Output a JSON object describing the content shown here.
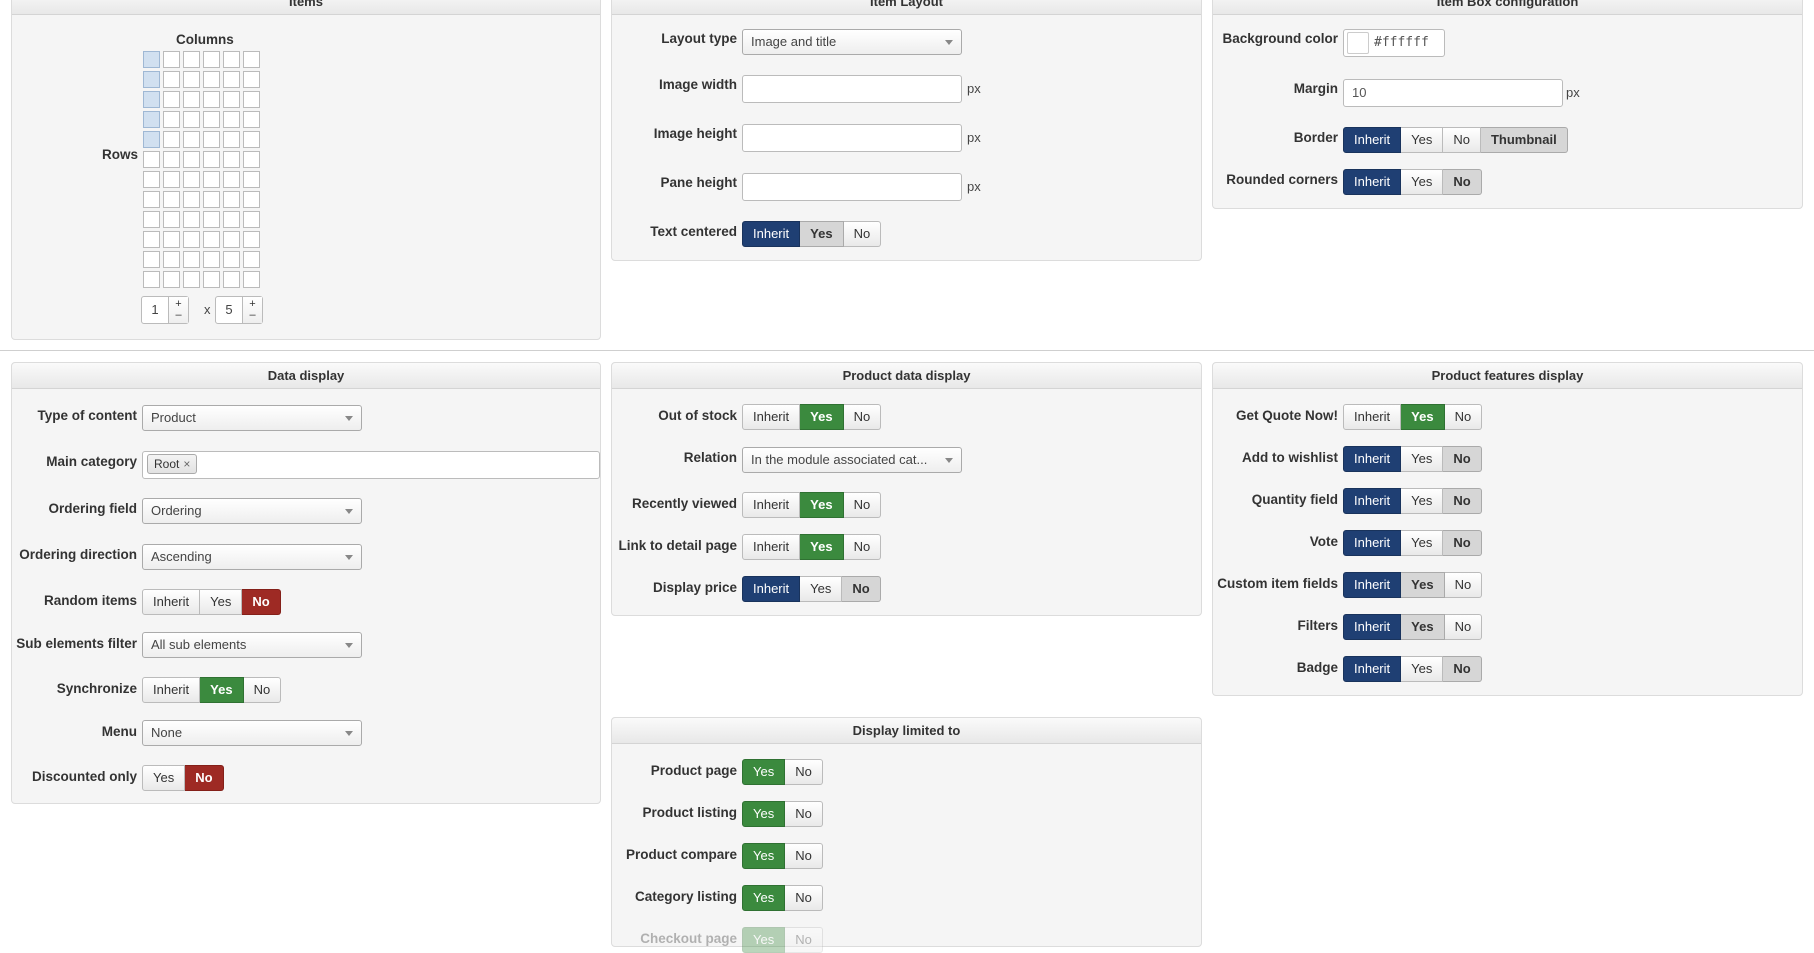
{
  "items_panel": {
    "title": "Items",
    "columns_label": "Columns",
    "rows_label": "Rows",
    "rows_value": "1",
    "cols_value": "5",
    "times_label": "x",
    "plus": "+",
    "minus": "–"
  },
  "item_layout": {
    "title": "Item Layout",
    "layout_type_label": "Layout type",
    "layout_type_value": "Image and title",
    "image_width_label": "Image width",
    "image_height_label": "Image height",
    "pane_height_label": "Pane height",
    "unit": "px",
    "text_centered_label": "Text centered",
    "opt_inherit": "Inherit",
    "opt_yes": "Yes",
    "opt_no": "No"
  },
  "item_box": {
    "title": "Item Box configuration",
    "bg_color_label": "Background color",
    "bg_color_value": "#ffffff",
    "margin_label": "Margin",
    "margin_value": "10",
    "unit": "px",
    "border_label": "Border",
    "thumbnail": "Thumbnail",
    "rounded_label": "Rounded corners",
    "opt_inherit": "Inherit",
    "opt_yes": "Yes",
    "opt_no": "No"
  },
  "data_display": {
    "title": "Data display",
    "type_label": "Type of content",
    "type_value": "Product",
    "main_cat_label": "Main category",
    "main_cat_tag": "Root",
    "tag_remove": "×",
    "ordering_field_label": "Ordering field",
    "ordering_field_value": "Ordering",
    "ordering_dir_label": "Ordering direction",
    "ordering_dir_value": "Ascending",
    "random_label": "Random items",
    "sub_filter_label": "Sub elements filter",
    "sub_filter_value": "All sub elements",
    "sync_label": "Synchronize",
    "menu_label": "Menu",
    "menu_value": "None",
    "discounted_label": "Discounted only",
    "opt_inherit": "Inherit",
    "opt_yes": "Yes",
    "opt_no": "No"
  },
  "product_data": {
    "title": "Product data display",
    "out_of_stock_label": "Out of stock",
    "relation_label": "Relation",
    "relation_value": "In the module associated cat...",
    "recently_viewed_label": "Recently viewed",
    "link_detail_label": "Link to detail page",
    "display_price_label": "Display price",
    "opt_inherit": "Inherit",
    "opt_yes": "Yes",
    "opt_no": "No"
  },
  "product_features": {
    "title": "Product features display",
    "quote_label": "Get Quote Now!",
    "wishlist_label": "Add to wishlist",
    "quantity_label": "Quantity field",
    "vote_label": "Vote",
    "custom_fields_label": "Custom item fields",
    "filters_label": "Filters",
    "badge_label": "Badge",
    "opt_inherit": "Inherit",
    "opt_yes": "Yes",
    "opt_no": "No"
  },
  "display_limited": {
    "title": "Display limited to",
    "product_page_label": "Product page",
    "product_listing_label": "Product listing",
    "product_compare_label": "Product compare",
    "category_listing_label": "Category listing",
    "checkout_page_label": "Checkout page",
    "opt_yes": "Yes",
    "opt_no": "No"
  },
  "colors": {
    "inherit_active": "#1f3f73",
    "yes_active": "#3b8a3e",
    "no_active": "#9e2a24",
    "grid_selected": "#d1e0f0"
  }
}
